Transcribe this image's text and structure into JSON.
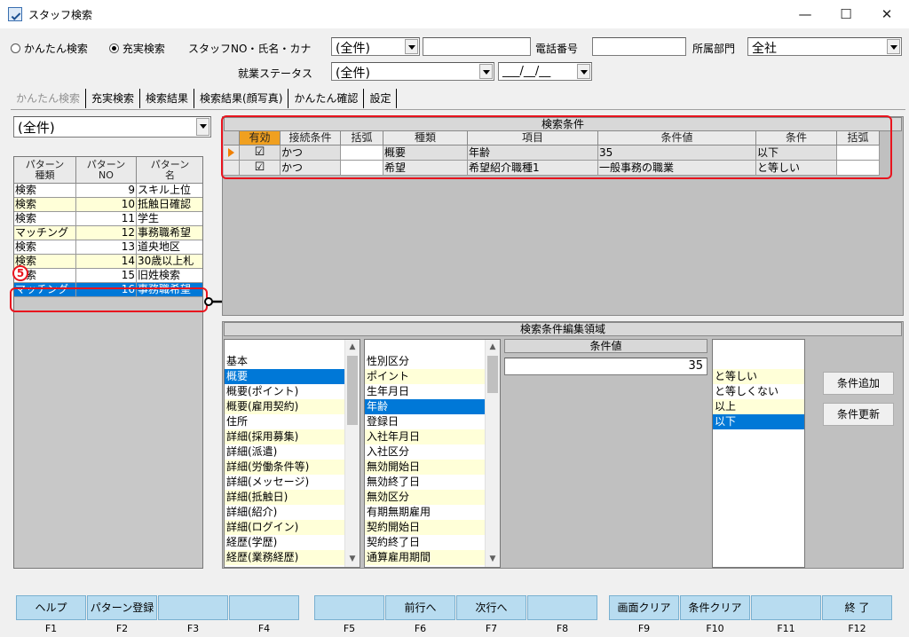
{
  "window": {
    "title": "スタッフ検索",
    "minimize": "—",
    "maximize": "☐",
    "close": "✕"
  },
  "search_mode": {
    "simple": "かんたん検索",
    "full": "充実検索",
    "selected": "full"
  },
  "filters": {
    "staff_label": "スタッフNO・氏名・カナ",
    "staff_combo": "(全件)",
    "staff_text": "",
    "phone_label": "電話番号",
    "phone_value": "",
    "dept_label": "所属部門",
    "dept_value": "全社",
    "status_label": "就業ステータス",
    "status_value": "(全件)",
    "date_value": "___/__/__"
  },
  "tabs": [
    "かんたん検索",
    "充実検索",
    "検索結果",
    "検索結果(顔写真)",
    "かんたん確認",
    "設定"
  ],
  "pattern_filter": "(全件)",
  "pattern_grid": {
    "headers": [
      "パターン\n種類",
      "パターン\nNO",
      "パターン\n名"
    ],
    "rows": [
      {
        "type": "検索",
        "no": "9",
        "name": "スキル上位"
      },
      {
        "type": "検索",
        "no": "10",
        "name": "抵触日確認"
      },
      {
        "type": "検索",
        "no": "11",
        "name": "学生"
      },
      {
        "type": "マッチング",
        "no": "12",
        "name": "事務職希望"
      },
      {
        "type": "検索",
        "no": "13",
        "name": "道央地区"
      },
      {
        "type": "検索",
        "no": "14",
        "name": "30歳以上札"
      },
      {
        "type": "検索",
        "no": "15",
        "name": "旧姓検索"
      },
      {
        "type": "マッチング",
        "no": "16",
        "name": "事務職希望"
      }
    ],
    "selected_row": 7
  },
  "callout_number": "5",
  "conditions": {
    "title": "検索条件",
    "headers": [
      "有効",
      "接続条件",
      "括弧",
      "種類",
      "項目",
      "条件値",
      "条件",
      "括弧"
    ],
    "rows": [
      {
        "enabled": "☑",
        "connect": "かつ",
        "paren_open": "",
        "kind": "概要",
        "item": "年齢",
        "value": "35",
        "cond": "以下",
        "paren_close": ""
      },
      {
        "enabled": "☑",
        "connect": "かつ",
        "paren_open": "",
        "kind": "希望",
        "item": "希望紹介職種1",
        "value": "一般事務の職業",
        "cond": "と等しい",
        "paren_close": ""
      }
    ]
  },
  "editor": {
    "title": "検索条件編集領域",
    "kind_header": "種類",
    "item_header": "項目",
    "value_header": "条件値",
    "cond_header": "条件",
    "kinds": [
      "基本",
      "概要",
      "概要(ポイント)",
      "概要(雇用契約)",
      "住所",
      "詳細(採用募集)",
      "詳細(派遣)",
      "詳細(労働条件等)",
      "詳細(メッセージ)",
      "詳細(抵触日)",
      "詳細(紹介)",
      "詳細(ログイン)",
      "経歴(学歴)",
      "経歴(業務経歴)"
    ],
    "kinds_selected": 1,
    "items": [
      "性別区分",
      "ポイント",
      "生年月日",
      "年齢",
      "登録日",
      "入社年月日",
      "入社区分",
      "無効開始日",
      "無効終了日",
      "無効区分",
      "有期無期雇用",
      "契約開始日",
      "契約終了日",
      "通算雇用期間"
    ],
    "items_selected": 3,
    "value": "35",
    "conds": [
      "",
      "と等しい",
      "と等しくない",
      "以上",
      "以下"
    ],
    "conds_selected": 4,
    "add_button": "条件追加",
    "update_button": "条件更新"
  },
  "fkeys": [
    {
      "label": "ヘルプ",
      "num": "F1"
    },
    {
      "label": "パターン登録",
      "num": "F2"
    },
    {
      "label": "",
      "num": "F3"
    },
    {
      "label": "",
      "num": "F4"
    },
    {
      "label": "",
      "num": "F5"
    },
    {
      "label": "前行へ",
      "num": "F6"
    },
    {
      "label": "次行へ",
      "num": "F7"
    },
    {
      "label": "",
      "num": "F8"
    },
    {
      "label": "画面クリア",
      "num": "F9"
    },
    {
      "label": "条件クリア",
      "num": "F10"
    },
    {
      "label": "",
      "num": "F11"
    },
    {
      "label": "終 了",
      "num": "F12"
    }
  ]
}
